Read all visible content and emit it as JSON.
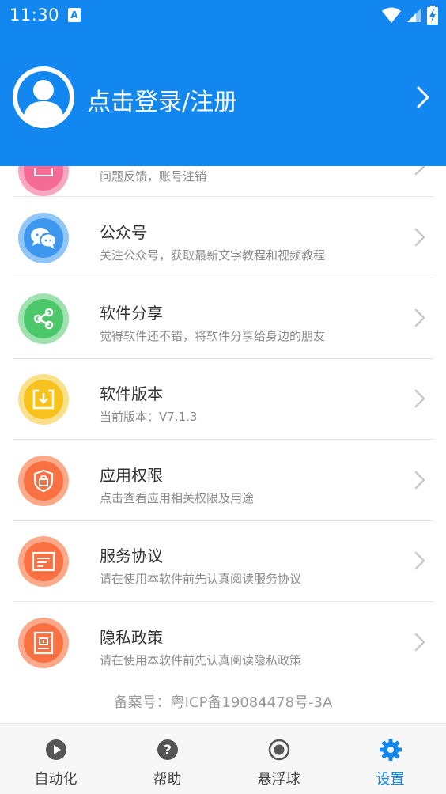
{
  "status_bar": {
    "time": "11:30",
    "notification_letter": "A"
  },
  "header": {
    "login_text": "点击登录/注册"
  },
  "partial_item": {
    "subtitle": "问题反馈，账号注销"
  },
  "items": [
    {
      "title": "公众号",
      "subtitle": "关注公众号，获取最新文字教程和视频教程",
      "icon": "wechat-icon"
    },
    {
      "title": "软件分享",
      "subtitle": "觉得软件还不错，将软件分享给身边的朋友",
      "icon": "share-icon"
    },
    {
      "title": "软件版本",
      "subtitle": "当前版本：V7.1.3",
      "icon": "download-icon"
    },
    {
      "title": "应用权限",
      "subtitle": "点击查看应用相关权限及用途",
      "icon": "shield-lock-icon"
    },
    {
      "title": "服务协议",
      "subtitle": "请在使用本软件前先认真阅读服务协议",
      "icon": "document-icon"
    },
    {
      "title": "隐私政策",
      "subtitle": "请在使用本软件前先认真阅读隐私政策",
      "icon": "privacy-doc-icon"
    }
  ],
  "record_number": "备案号：粤ICP备19084478号-3A",
  "bottom_nav": [
    {
      "label": "自动化",
      "icon": "play-circle-icon"
    },
    {
      "label": "帮助",
      "icon": "help-circle-icon"
    },
    {
      "label": "悬浮球",
      "icon": "radio-button-icon"
    },
    {
      "label": "设置",
      "icon": "gear-icon",
      "active": true
    }
  ],
  "colors": {
    "primary": "#1387f0",
    "wechat": "#3d97ef",
    "share": "#4cc86a",
    "version": "#f7c21d",
    "permission": "#f97142",
    "agreement": "#f97142",
    "privacy": "#f97142",
    "partial": "#f46b96"
  }
}
